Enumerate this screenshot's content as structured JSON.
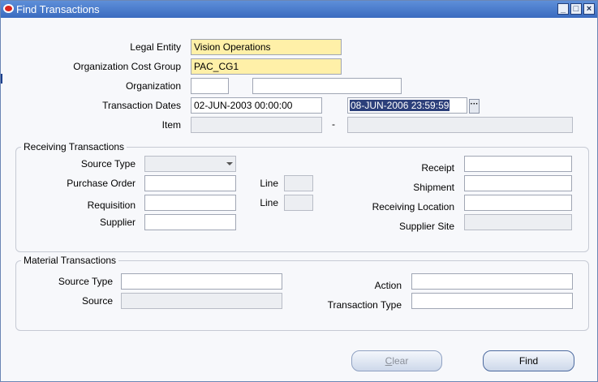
{
  "window": {
    "title": "Find Transactions"
  },
  "top": {
    "legal_entity": {
      "label": "Legal Entity",
      "value": "Vision Operations"
    },
    "org_cost_group": {
      "label": "Organization Cost Group",
      "value": "PAC_CG1"
    },
    "organization": {
      "label": "Organization",
      "code": "",
      "name": ""
    },
    "transaction_dates": {
      "label": "Transaction Dates",
      "from": "02-JUN-2003 00:00:00",
      "to": "08-JUN-2006 23:59:59"
    },
    "item": {
      "label": "Item",
      "from": "",
      "to": "",
      "separator": "-"
    }
  },
  "receiving": {
    "title": "Receiving Transactions",
    "source_type": {
      "label": "Source Type",
      "value": ""
    },
    "purchase_order": {
      "label": "Purchase Order",
      "value": ""
    },
    "po_line": {
      "label": "Line",
      "value": ""
    },
    "requisition": {
      "label": "Requisition",
      "value": ""
    },
    "req_line": {
      "label": "Line",
      "value": ""
    },
    "supplier": {
      "label": "Supplier",
      "value": ""
    },
    "receipt": {
      "label": "Receipt",
      "value": ""
    },
    "shipment": {
      "label": "Shipment",
      "value": ""
    },
    "receiving_location": {
      "label": "Receiving Location",
      "value": ""
    },
    "supplier_site": {
      "label": "Supplier Site",
      "value": ""
    }
  },
  "material": {
    "title": "Material Transactions",
    "source_type": {
      "label": "Source Type",
      "value": ""
    },
    "source": {
      "label": "Source",
      "value": ""
    },
    "action": {
      "label": "Action",
      "value": ""
    },
    "transaction_type": {
      "label": "Transaction Type",
      "value": ""
    }
  },
  "buttons": {
    "clear_mnemonic": "C",
    "clear_rest": "lear",
    "find": "Find"
  },
  "icons": {
    "app": "oracle-logo-icon",
    "lov": "ellipsis-icon",
    "combo": "chevron-down-icon"
  },
  "colors": {
    "required_field": "#fff0a8",
    "readonly_field": "#eceef2",
    "titlebar": "#3a6bbf"
  }
}
